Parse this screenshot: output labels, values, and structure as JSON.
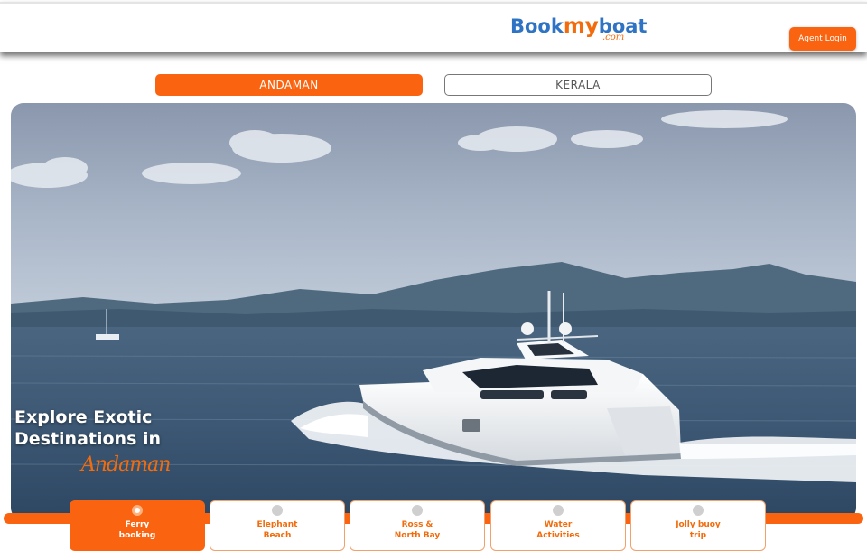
{
  "header": {
    "logo": {
      "book": "Book",
      "my": "my",
      "boat": "boat",
      "dotcom": ".com"
    },
    "agent_login_label": "Agent Login"
  },
  "tabs": [
    {
      "label": "ANDAMAN",
      "active": true
    },
    {
      "label": "KERALA",
      "active": false
    }
  ],
  "hero": {
    "headline_line1": "Explore Exotic",
    "headline_line2": "Destinations in",
    "script_text": "Andaman"
  },
  "services": [
    {
      "line1": "Ferry",
      "line2": "booking",
      "active": true
    },
    {
      "line1": "Elephant",
      "line2": "Beach",
      "active": false
    },
    {
      "line1": "Ross &",
      "line2": "North Bay",
      "active": false
    },
    {
      "line1": "Water",
      "line2": "Activities",
      "active": false
    },
    {
      "line1": "Jolly buoy",
      "line2": "trip",
      "active": false
    }
  ],
  "colors": {
    "accent": "#fa6410",
    "brand_blue": "#2f74c4"
  }
}
